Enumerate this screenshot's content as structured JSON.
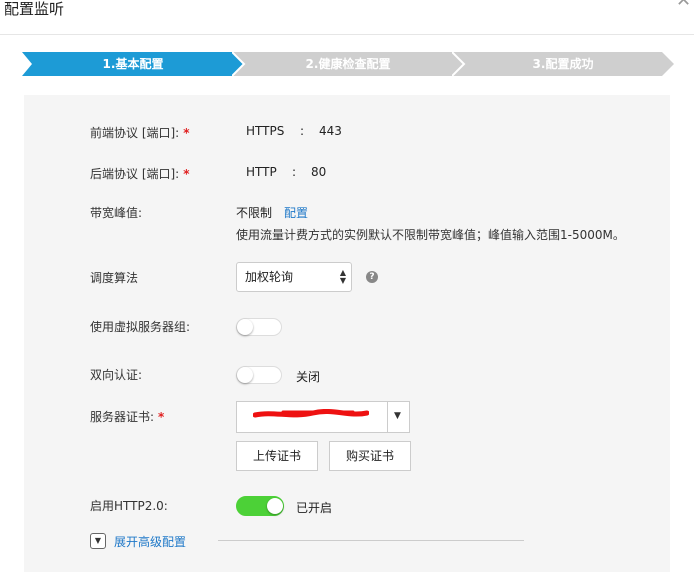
{
  "dialog": {
    "title": "配置监听"
  },
  "steps": [
    {
      "label": "1.基本配置",
      "active": true
    },
    {
      "label": "2.健康检查配置",
      "active": false
    },
    {
      "label": "3.配置成功",
      "active": false
    }
  ],
  "colors": {
    "active_step": "#1d9bd6",
    "inactive_step": "#cfcfcf",
    "toggle_on": "#4cd137",
    "link": "#1e78c8",
    "required": "#e02020"
  },
  "frontend": {
    "label": "前端协议 [端口]:",
    "required_mark": "*",
    "protocol": "HTTPS",
    "sep": ":",
    "port": "443"
  },
  "backend": {
    "label": "后端协议 [端口]:",
    "required_mark": "*",
    "protocol": "HTTP",
    "sep": ":",
    "port": "80"
  },
  "bandwidth": {
    "label": "带宽峰值:",
    "value": "不限制",
    "link": "配置",
    "hint": "使用流量计费方式的实例默认不限制带宽峰值；峰值输入范围1-5000M。"
  },
  "scheduling": {
    "label": "调度算法",
    "selected": "加权轮询",
    "help_icon": "question-icon"
  },
  "vserver_group": {
    "label": "使用虚拟服务器组:",
    "enabled": false
  },
  "mutual_auth": {
    "label": "双向认证:",
    "enabled": false,
    "status": "关闭"
  },
  "server_cert": {
    "label": "服务器证书:",
    "required_mark": "*",
    "upload_label": "上传证书",
    "buy_label": "购买证书"
  },
  "http2": {
    "label": "启用HTTP2.0:",
    "enabled": true,
    "status": "已开启"
  },
  "advanced": {
    "label": "展开高级配置"
  }
}
